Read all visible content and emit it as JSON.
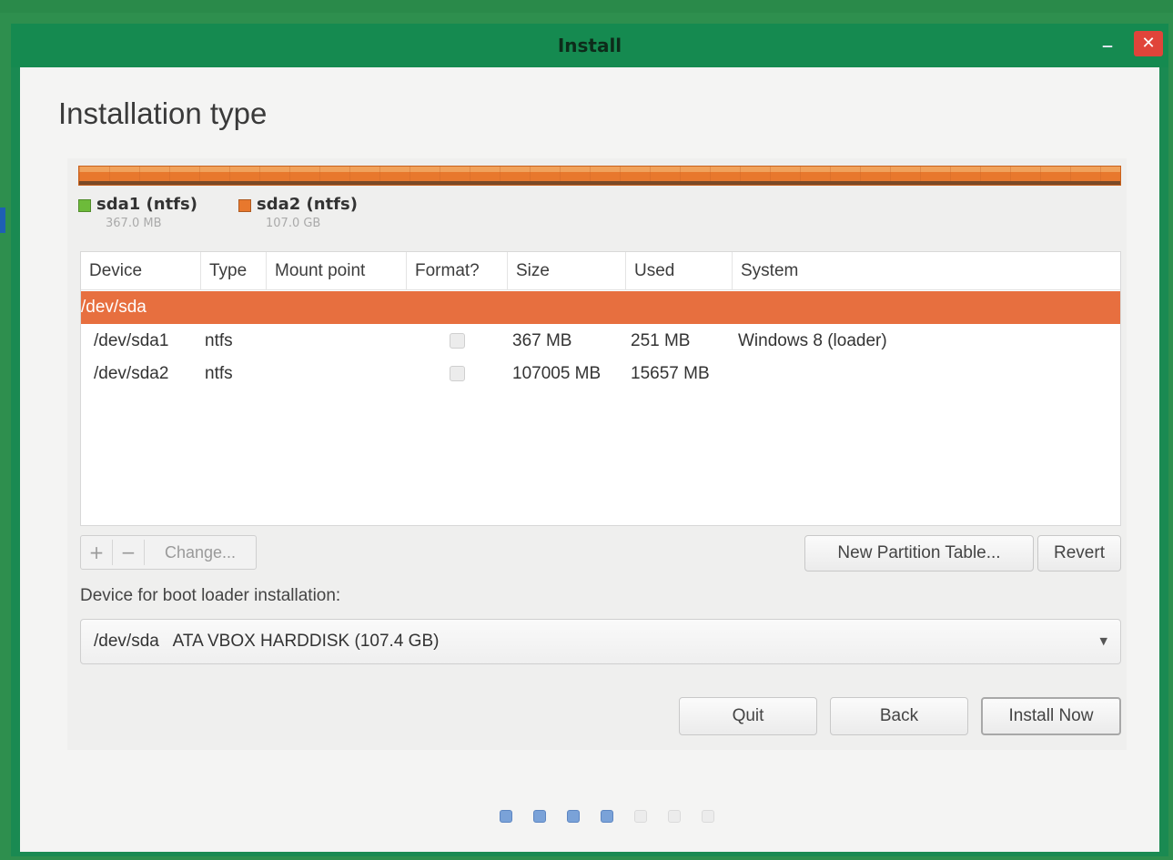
{
  "window": {
    "title": "Install",
    "minimize_glyph": "–",
    "close_glyph": "✕",
    "accent_color": "#158a50",
    "close_color": "#e0443a"
  },
  "page": {
    "title": "Installation type"
  },
  "partition_bar": {
    "color": "#e8782d"
  },
  "legend": [
    {
      "label": "sda1 (ntfs)",
      "size": "367.0 MB",
      "color": "#6dbb3a"
    },
    {
      "label": "sda2 (ntfs)",
      "size": "107.0 GB",
      "color": "#e8782d"
    }
  ],
  "table": {
    "columns": [
      "Device",
      "Type",
      "Mount point",
      "Format?",
      "Size",
      "Used",
      "System"
    ],
    "selected_row": {
      "device": "/dev/sda"
    },
    "rows": [
      {
        "device": "/dev/sda1",
        "type": "ntfs",
        "mount": "",
        "format": false,
        "size": "367 MB",
        "used": "251 MB",
        "system": "Windows 8 (loader)"
      },
      {
        "device": "/dev/sda2",
        "type": "ntfs",
        "mount": "",
        "format": false,
        "size": "107005 MB",
        "used": "15657 MB",
        "system": ""
      }
    ],
    "selection_color": "#e76f3f"
  },
  "toolbar": {
    "add_label": "+",
    "remove_label": "−",
    "change_label": "Change...",
    "new_table_label": "New Partition Table...",
    "revert_label": "Revert"
  },
  "boot_loader": {
    "label": "Device for boot loader installation:",
    "value": "/dev/sda   ATA VBOX HARDDISK (107.4 GB)",
    "arrow_icon": "▼"
  },
  "actions": {
    "quit_label": "Quit",
    "back_label": "Back",
    "install_label": "Install Now"
  },
  "progress": {
    "completed_steps": 4,
    "total_steps": 7
  }
}
